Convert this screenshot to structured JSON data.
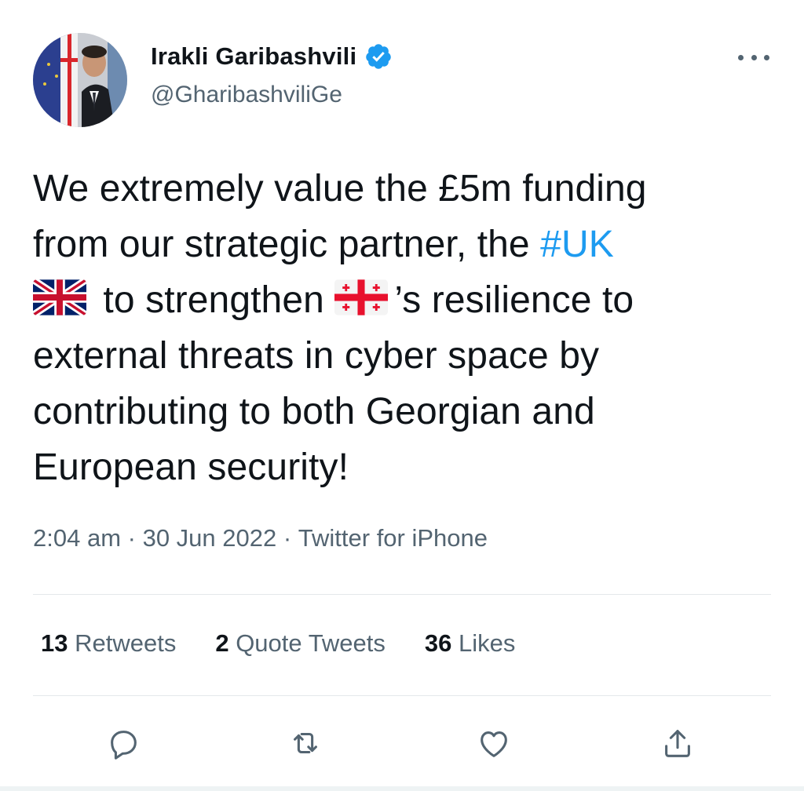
{
  "author": {
    "display_name": "Irakli Garibashvili",
    "handle": "@GharibashviliGe",
    "verified": true
  },
  "tweet": {
    "line1": "We extremely value the £5m funding",
    "line2_prefix": "from our strategic partner, the ",
    "hashtag": "#UK",
    "line3_mid": " to strengthen ",
    "line3_suffix": "’s resilience to",
    "line4": "external threats in cyber space by",
    "line5": "contributing to both Georgian and",
    "line6": "European security!",
    "flag_1": "united-kingdom-flag",
    "flag_2": "georgia-flag"
  },
  "meta": {
    "time": "2:04 am",
    "separator": " · ",
    "date": "30 Jun 2022",
    "source": "Twitter for iPhone"
  },
  "stats": {
    "retweets_count": "13",
    "retweets_label": " Retweets",
    "quotes_count": "2",
    "quotes_label": " Quote Tweets",
    "likes_count": "36",
    "likes_label": " Likes"
  },
  "actions": {
    "reply_icon": "reply-icon",
    "retweet_icon": "retweet-icon",
    "like_icon": "heart-icon",
    "share_icon": "share-icon"
  },
  "colors": {
    "accent": "#1d9bf0",
    "secondary_text": "#536471",
    "primary_text": "#0f1419"
  }
}
